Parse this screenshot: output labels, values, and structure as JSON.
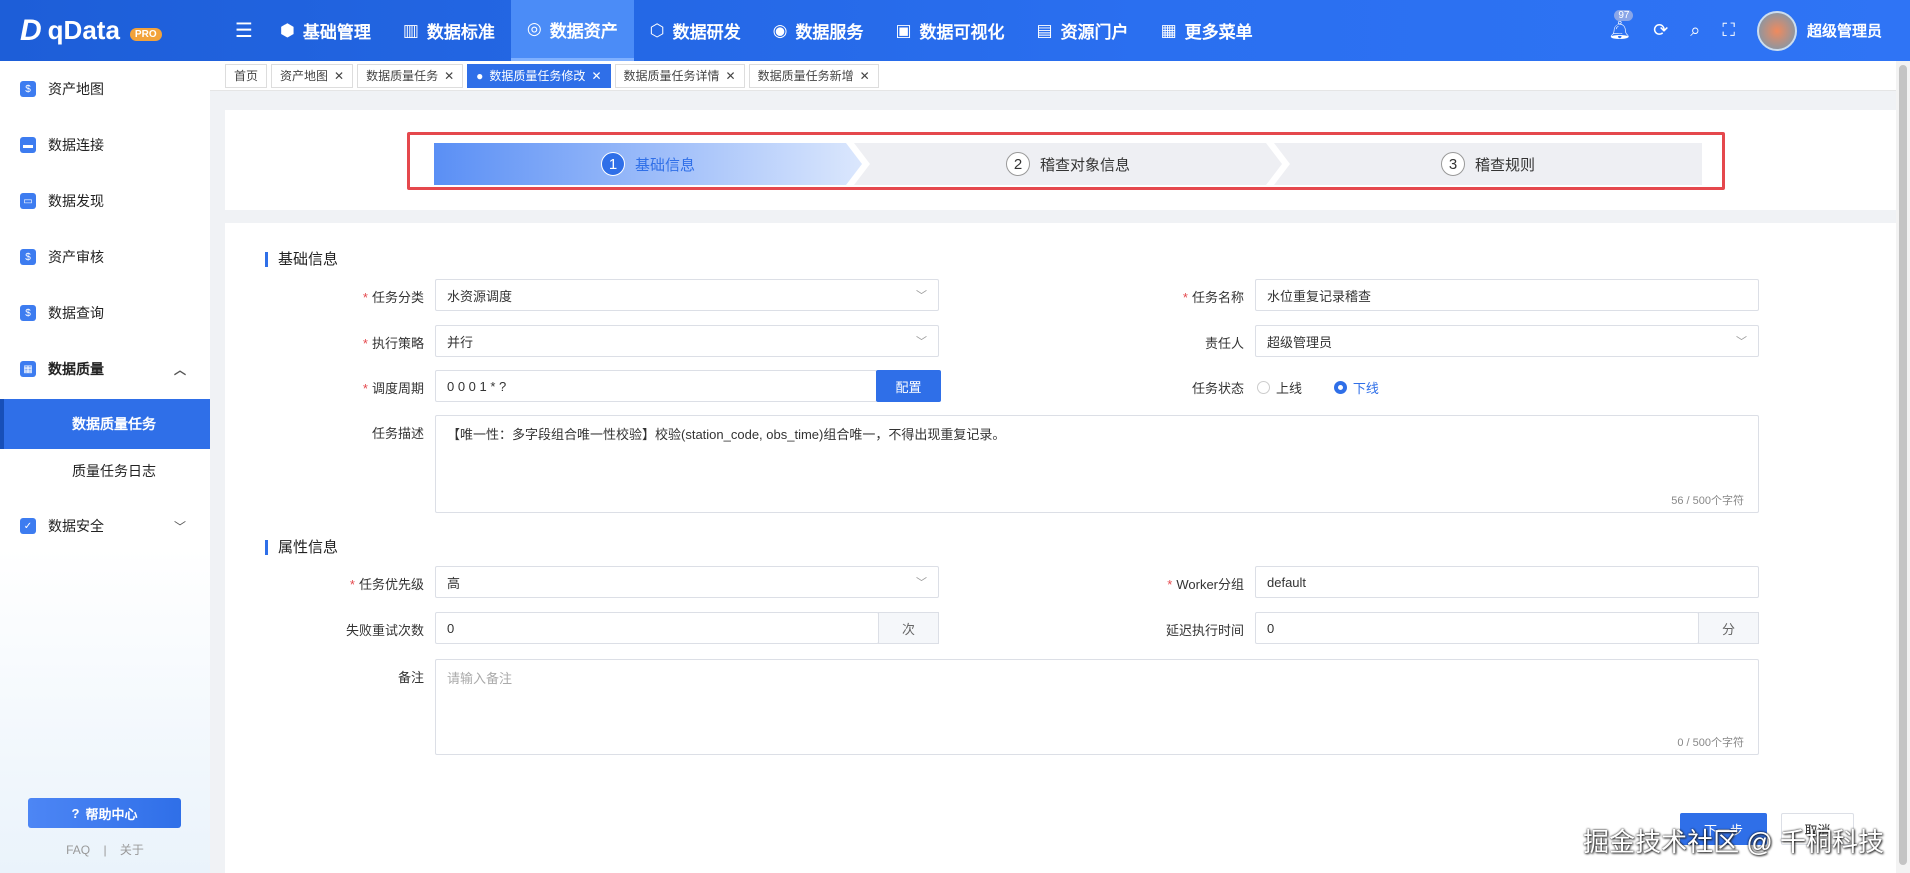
{
  "header": {
    "logo": "qData",
    "pro": "PRO",
    "nav": [
      {
        "label": "基础管理",
        "icon": "cube"
      },
      {
        "label": "数据标准",
        "icon": "book"
      },
      {
        "label": "数据资产",
        "icon": "target",
        "active": true
      },
      {
        "label": "数据研发",
        "icon": "hex"
      },
      {
        "label": "数据服务",
        "icon": "ring"
      },
      {
        "label": "数据可视化",
        "icon": "chart"
      },
      {
        "label": "资源门户",
        "icon": "layout"
      },
      {
        "label": "更多菜单",
        "icon": "grid"
      }
    ],
    "badge": "97",
    "user": "超级管理员"
  },
  "sidebar": {
    "items": [
      "资产地图",
      "数据连接",
      "数据发现",
      "资产审核",
      "数据查询",
      "数据质量"
    ],
    "sub": [
      "数据质量任务",
      "质量任务日志"
    ],
    "last": "数据安全",
    "help": "帮助中心",
    "faq": "FAQ",
    "sep": "|",
    "about": "关于"
  },
  "tabs": [
    {
      "label": "首页"
    },
    {
      "label": "资产地图"
    },
    {
      "label": "数据质量任务"
    },
    {
      "label": "数据质量任务修改",
      "active": true
    },
    {
      "label": "数据质量任务详情"
    },
    {
      "label": "数据质量任务新增"
    }
  ],
  "steps": [
    {
      "num": "1",
      "label": "基础信息"
    },
    {
      "num": "2",
      "label": "稽查对象信息"
    },
    {
      "num": "3",
      "label": "稽查规则"
    }
  ],
  "form": {
    "sec1": "基础信息",
    "sec2": "属性信息",
    "category_label": "任务分类",
    "category": "水资源调度",
    "name_label": "任务名称",
    "name": "水位重复记录稽查",
    "strategy_label": "执行策略",
    "strategy": "并行",
    "owner_label": "责任人",
    "owner": "超级管理员",
    "cron_label": "调度周期",
    "cron": "0 0 0 1 * ?",
    "config": "配置",
    "status_label": "任务状态",
    "status_on": "上线",
    "status_off": "下线",
    "desc_label": "任务描述",
    "desc": "【唯一性：多字段组合唯一性校验】校验(station_code, obs_time)组合唯一，不得出现重复记录。",
    "desc_count": "56 / 500个字符",
    "priority_label": "任务优先级",
    "priority": "高",
    "worker_label": "Worker分组",
    "worker": "default",
    "retry_label": "失败重试次数",
    "retry": "0",
    "retry_unit": "次",
    "delay_label": "延迟执行时间",
    "delay": "0",
    "delay_unit": "分",
    "remark_label": "备注",
    "remark_ph": "请输入备注",
    "remark_count": "0 / 500个字符"
  },
  "buttons": {
    "next": "下一步",
    "cancel": "取消"
  },
  "watermark": "掘金技术社区 @ 千桐科技"
}
